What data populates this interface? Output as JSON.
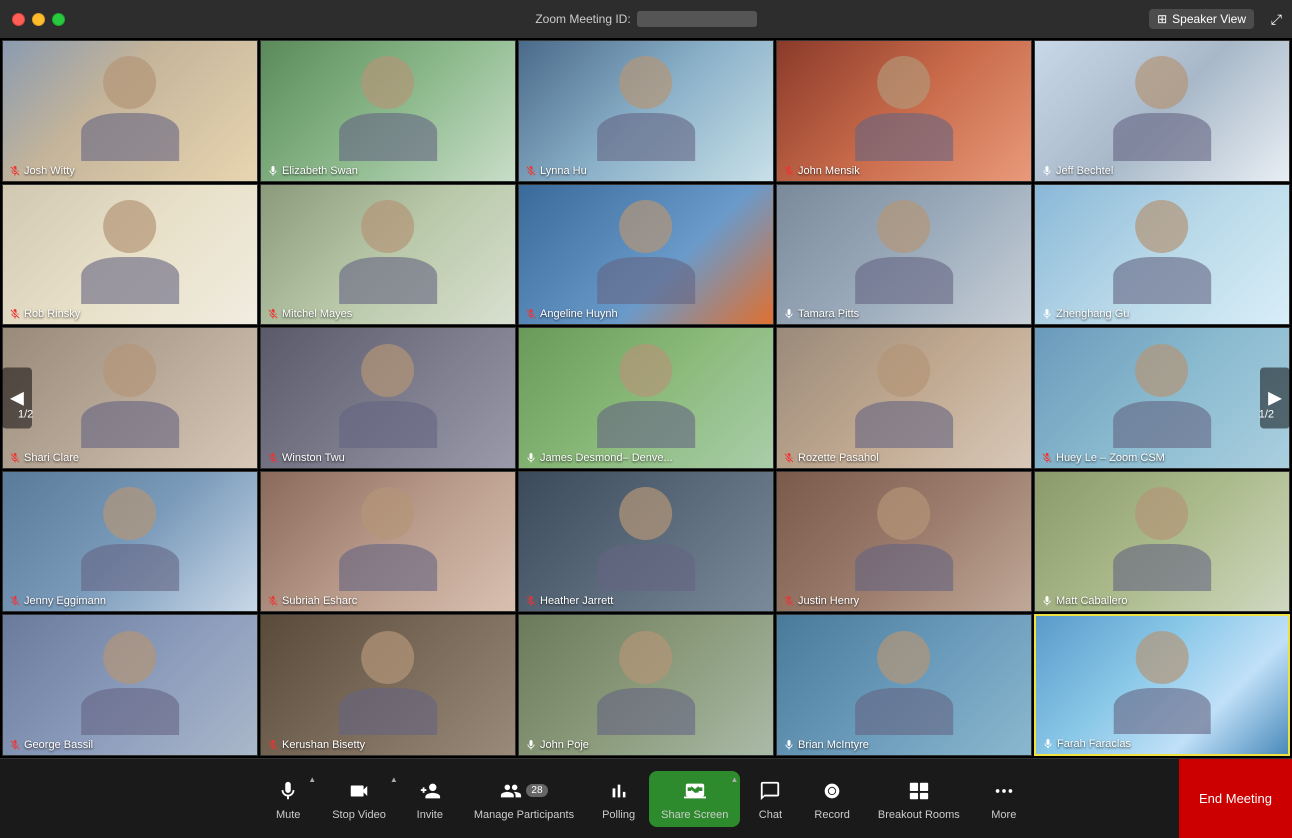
{
  "titlebar": {
    "meeting_label": "Zoom Meeting ID:",
    "speaker_view": "Speaker View"
  },
  "participants": [
    {
      "name": "Josh Witty",
      "muted": true,
      "row": 0,
      "col": 0
    },
    {
      "name": "Elizabeth Swan",
      "muted": false,
      "row": 0,
      "col": 1
    },
    {
      "name": "Lynna Hu",
      "muted": true,
      "row": 0,
      "col": 2
    },
    {
      "name": "John Mensik",
      "muted": true,
      "row": 0,
      "col": 3
    },
    {
      "name": "Jeff Bechtel",
      "muted": false,
      "row": 0,
      "col": 4
    },
    {
      "name": "Rob Rinsky",
      "muted": true,
      "row": 1,
      "col": 0
    },
    {
      "name": "Mitchel Mayes",
      "muted": true,
      "row": 1,
      "col": 1
    },
    {
      "name": "Angeline Huynh",
      "muted": true,
      "row": 1,
      "col": 2
    },
    {
      "name": "Tamara Pitts",
      "muted": false,
      "row": 1,
      "col": 3
    },
    {
      "name": "Zhenghang Gu",
      "muted": false,
      "row": 1,
      "col": 4
    },
    {
      "name": "Shari Clare",
      "muted": true,
      "row": 2,
      "col": 0
    },
    {
      "name": "Winston Twu",
      "muted": true,
      "row": 2,
      "col": 1
    },
    {
      "name": "James Desmond– Denve...",
      "muted": false,
      "row": 2,
      "col": 2
    },
    {
      "name": "Rozette Pasahol",
      "muted": true,
      "row": 2,
      "col": 3
    },
    {
      "name": "Huey Le – Zoom CSM",
      "muted": true,
      "row": 2,
      "col": 4
    },
    {
      "name": "Jenny Eggimann",
      "muted": true,
      "row": 3,
      "col": 0
    },
    {
      "name": "Subriah Esharc",
      "muted": true,
      "row": 3,
      "col": 1
    },
    {
      "name": "Heather Jarrett",
      "muted": true,
      "row": 3,
      "col": 2
    },
    {
      "name": "Justin Henry",
      "muted": true,
      "row": 3,
      "col": 3
    },
    {
      "name": "Matt Caballero",
      "muted": false,
      "row": 3,
      "col": 4
    },
    {
      "name": "George Bassil",
      "muted": true,
      "row": 4,
      "col": 0
    },
    {
      "name": "Kerushan Bisetty",
      "muted": true,
      "row": 4,
      "col": 1
    },
    {
      "name": "John Poje",
      "muted": false,
      "row": 4,
      "col": 2
    },
    {
      "name": "Brian McIntyre",
      "muted": false,
      "row": 4,
      "col": 3
    },
    {
      "name": "Farah Faraclas",
      "muted": false,
      "row": 4,
      "col": 4,
      "highlighted": true
    }
  ],
  "navigation": {
    "left_arrow": "◀",
    "right_arrow": "▶",
    "page_label": "1/2"
  },
  "toolbar": {
    "mute_label": "Mute",
    "stop_video_label": "Stop Video",
    "invite_label": "Invite",
    "manage_participants_label": "Manage Participants",
    "participants_count": "28",
    "polling_label": "Polling",
    "share_screen_label": "Share Screen",
    "chat_label": "Chat",
    "record_label": "Record",
    "breakout_rooms_label": "Breakout Rooms",
    "more_label": "More",
    "end_meeting_label": "End Meeting"
  }
}
